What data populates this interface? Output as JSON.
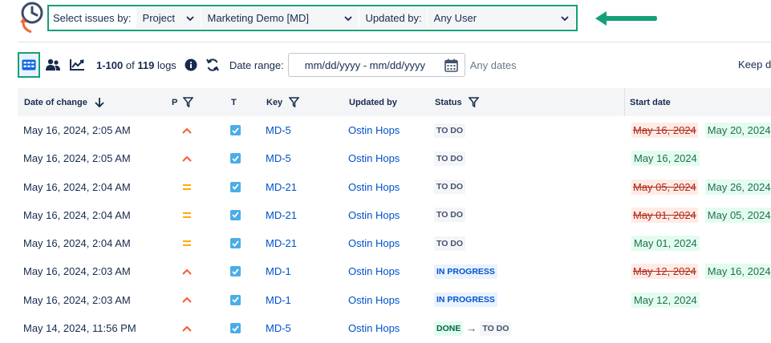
{
  "filter": {
    "select_by_label": "Select issues by:",
    "select_by_value": "Project",
    "project_value": "Marketing Demo [MD]",
    "updated_by_label": "Updated by:",
    "updated_by_value": "Any User"
  },
  "toolbar": {
    "range": "1-100",
    "of": "of",
    "total": "119",
    "logs": "logs",
    "date_range_label": "Date range:",
    "date_placeholder": "mm/dd/yyyy - mm/dd/yyyy",
    "any_dates": "Any dates",
    "keep_text": "Keep d"
  },
  "table": {
    "headers": {
      "date_of_change": "Date of change",
      "p": "P",
      "t": "T",
      "key": "Key",
      "updated_by": "Updated by",
      "status": "Status",
      "start_date": "Start date"
    },
    "rows": [
      {
        "date": "May 16, 2024, 2:05 AM",
        "priority": "high",
        "key": "MD-5",
        "user": "Ostin Hops",
        "status": [
          "TO DO"
        ],
        "status_type": [
          "todo"
        ],
        "start_old": "May 16, 2024",
        "start_new": "May 20, 2024"
      },
      {
        "date": "May 16, 2024, 2:05 AM",
        "priority": "high",
        "key": "MD-5",
        "user": "Ostin Hops",
        "status": [
          "TO DO"
        ],
        "status_type": [
          "todo"
        ],
        "start_old": "",
        "start_new": "May 16, 2024"
      },
      {
        "date": "May 16, 2024, 2:04 AM",
        "priority": "medium",
        "key": "MD-21",
        "user": "Ostin Hops",
        "status": [
          "TO DO"
        ],
        "status_type": [
          "todo"
        ],
        "start_old": "May 05, 2024",
        "start_new": "May 26, 2024"
      },
      {
        "date": "May 16, 2024, 2:04 AM",
        "priority": "medium",
        "key": "MD-21",
        "user": "Ostin Hops",
        "status": [
          "TO DO"
        ],
        "status_type": [
          "todo"
        ],
        "start_old": "May 01, 2024",
        "start_new": "May 05, 2024"
      },
      {
        "date": "May 16, 2024, 2:04 AM",
        "priority": "medium",
        "key": "MD-21",
        "user": "Ostin Hops",
        "status": [
          "TO DO"
        ],
        "status_type": [
          "todo"
        ],
        "start_old": "",
        "start_new": "May 01, 2024"
      },
      {
        "date": "May 16, 2024, 2:03 AM",
        "priority": "high",
        "key": "MD-1",
        "user": "Ostin Hops",
        "status": [
          "IN PROGRESS"
        ],
        "status_type": [
          "prog"
        ],
        "start_old": "May 12, 2024",
        "start_new": "May 16, 2024"
      },
      {
        "date": "May 16, 2024, 2:03 AM",
        "priority": "high",
        "key": "MD-1",
        "user": "Ostin Hops",
        "status": [
          "IN PROGRESS"
        ],
        "status_type": [
          "prog"
        ],
        "start_old": "",
        "start_new": "May 12, 2024"
      },
      {
        "date": "May 14, 2024, 11:56 PM",
        "priority": "high",
        "key": "MD-5",
        "user": "Ostin Hops",
        "status": [
          "DONE",
          "TO DO"
        ],
        "status_type": [
          "done",
          "todo"
        ],
        "start_old": "",
        "start_new": ""
      }
    ]
  },
  "colors": {
    "accent_green": "#15a07a",
    "link_blue": "#0052cc",
    "priority_high": "#ff5630",
    "priority_medium": "#ffab00",
    "checkbox_blue": "#4bade8"
  },
  "icons": {
    "logo": "history-clock-icon",
    "view_table": "table-grid-icon",
    "view_users": "users-icon",
    "view_chart": "trend-chart-icon",
    "info": "info-icon",
    "sync": "sync-icon",
    "calendar": "calendar-icon",
    "filter": "filter-icon",
    "sort": "arrow-down-icon"
  }
}
